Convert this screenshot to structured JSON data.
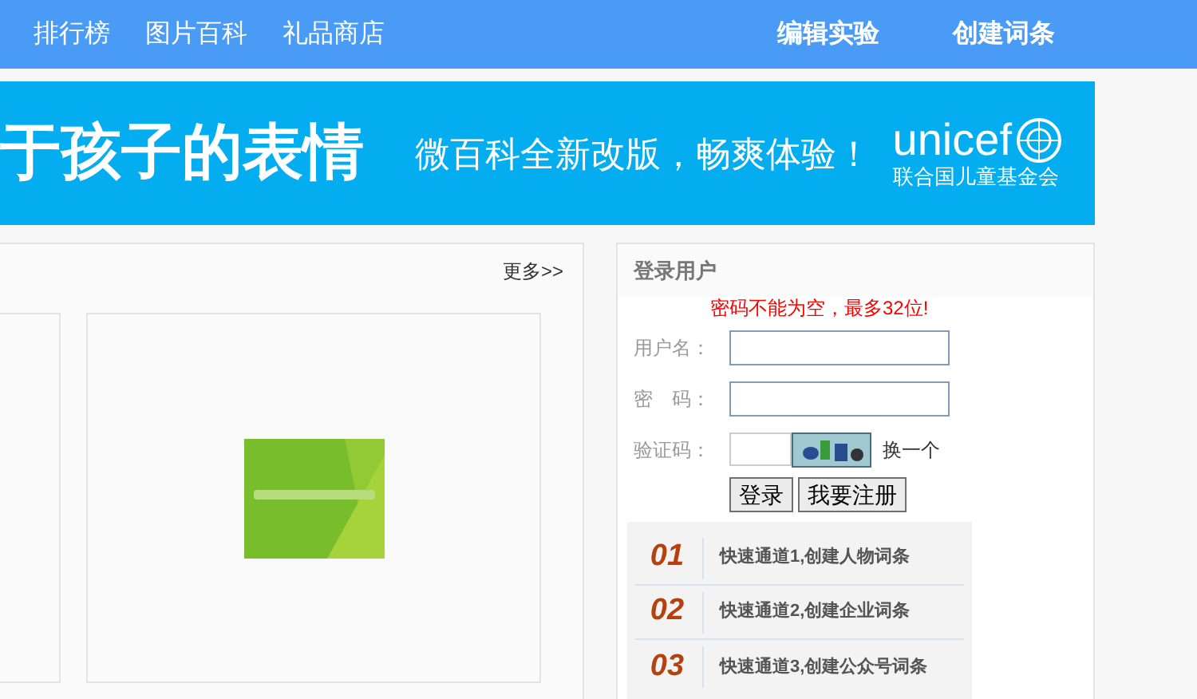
{
  "nav": {
    "left": [
      {
        "label": "排行榜"
      },
      {
        "label": "图片百科"
      },
      {
        "label": "礼品商店"
      }
    ],
    "right": [
      {
        "label": "编辑实验"
      },
      {
        "label": "创建词条"
      }
    ]
  },
  "banner": {
    "headline": "于孩子的表情",
    "slogan": "微百科全新改版，畅爽体验！",
    "logo_word": "unicef",
    "logo_caption": "联合国儿童基金会"
  },
  "gallery": {
    "more_link": "更多>>",
    "cards": [
      {
        "kind": "empty"
      },
      {
        "kind": "picture"
      }
    ]
  },
  "login": {
    "title": "登录用户",
    "error": "密码不能为空，最多32位!",
    "fields": [
      {
        "label": "用户名：",
        "kind": "text"
      },
      {
        "label": "密　码：",
        "kind": "password"
      },
      {
        "label": "验证码：",
        "kind": "captcha",
        "refresh": "换一个"
      }
    ],
    "buttons": [
      "登录",
      "我要注册"
    ]
  },
  "channels": [
    {
      "number": "01",
      "label": "快速通道1,创建人物词条"
    },
    {
      "number": "02",
      "label": "快速通道2,创建企业词条"
    },
    {
      "number": "03",
      "label": "快速通道3,创建公众号词条"
    }
  ]
}
